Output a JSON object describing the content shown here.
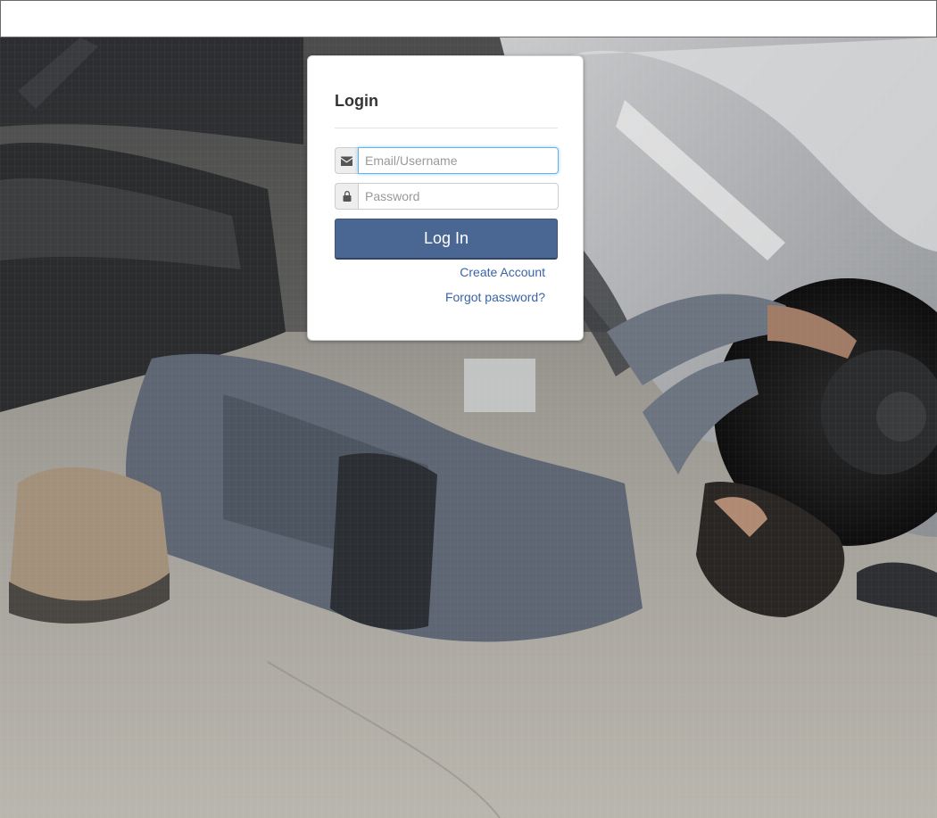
{
  "login": {
    "title": "Login",
    "email_placeholder": "Email/Username",
    "email_value": "",
    "password_placeholder": "Password",
    "password_value": "",
    "submit_label": "Log In",
    "create_account_label": "Create Account",
    "forgot_password_label": "Forgot password?"
  },
  "icons": {
    "email": "envelope-icon",
    "password": "lock-icon"
  },
  "colors": {
    "primary_button": "#4a6793",
    "link": "#3b63a6",
    "focus_ring": "#66afe9"
  }
}
